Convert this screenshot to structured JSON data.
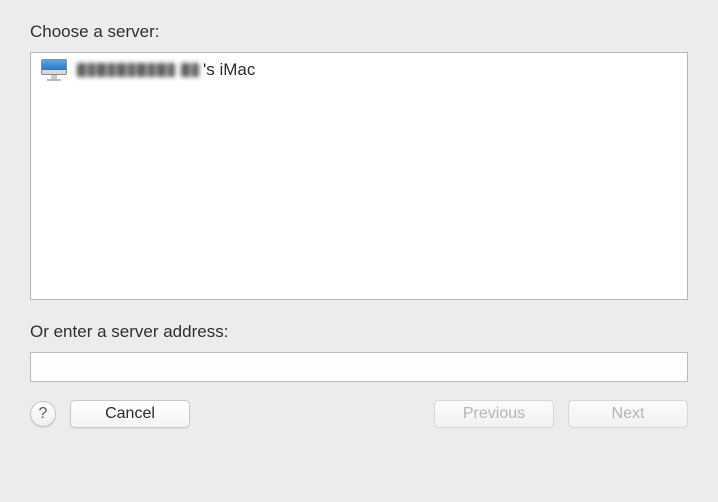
{
  "labels": {
    "choose_server": "Choose a server:",
    "enter_address": "Or enter a server address:"
  },
  "servers": [
    {
      "name_suffix": "'s iMac",
      "icon": "imac-icon"
    }
  ],
  "address": {
    "value": "",
    "placeholder": ""
  },
  "buttons": {
    "help": "?",
    "cancel": "Cancel",
    "previous": "Previous",
    "next": "Next"
  },
  "buttons_state": {
    "previous_enabled": false,
    "next_enabled": false
  }
}
